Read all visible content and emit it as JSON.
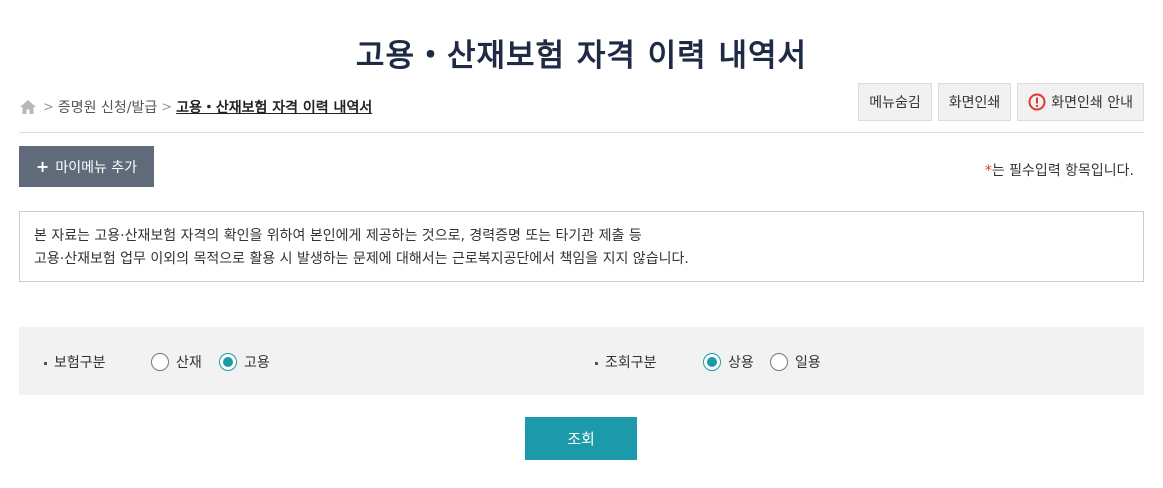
{
  "page": {
    "title": "고용・산재보험 자격 이력 내역서"
  },
  "breadcrumb": {
    "home_icon": "home-icon",
    "items": [
      "증명원 신청/발급",
      "고용・산재보험 자격 이력 내역서"
    ]
  },
  "toolbar": {
    "hide_menu_label": "메뉴숨김",
    "print_label": "화면인쇄",
    "print_guide_label": "화면인쇄 안내",
    "print_guide_icon": "warning-circle-icon",
    "warning_color": "#e0392b"
  },
  "mymenu": {
    "label": "마이메뉴 추가",
    "plus": "+"
  },
  "required_note": {
    "star": "*",
    "text": "는 필수입력 항목입니다."
  },
  "notice": {
    "line1": "본 자료는 고용·산재보험 자격의 확인을 위하여 본인에게 제공하는 것으로, 경력증명 또는 타기관 제출 등",
    "line2": "고용·산재보험 업무 이외의 목적으로 활용 시 발생하는 문제에 대해서는 근로복지공단에서 책임을 지지 않습니다."
  },
  "search": {
    "insurance_type": {
      "label": "보험구분",
      "options": [
        "산재",
        "고용"
      ],
      "selected": "고용"
    },
    "query_type": {
      "label": "조회구분",
      "options": [
        "상용",
        "일용"
      ],
      "selected": "상용"
    },
    "accent_color": "#1c9aaa",
    "submit_label": "조회"
  }
}
